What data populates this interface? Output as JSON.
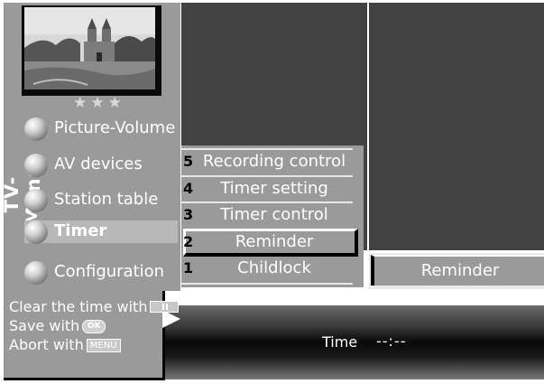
{
  "side_label": "TV-Menu",
  "rating_stars": "★★★",
  "main_menu": {
    "items": [
      {
        "label": "Picture-Volume"
      },
      {
        "label": "AV devices"
      },
      {
        "label": "Station table"
      },
      {
        "label": "Timer",
        "selected": true
      },
      {
        "label": "Configuration"
      }
    ]
  },
  "sub_menu": {
    "items": [
      {
        "number": "5",
        "label": "Recording control"
      },
      {
        "number": "4",
        "label": "Timer setting"
      },
      {
        "number": "3",
        "label": "Timer control"
      },
      {
        "number": "2",
        "label": "Reminder",
        "selected": true
      },
      {
        "number": "1",
        "label": "Childlock"
      }
    ]
  },
  "detail": {
    "title": "Reminder"
  },
  "help": {
    "clear_text": "Clear the time with",
    "save_text": "Save with",
    "abort_text": "Abort with",
    "ok_key": "OK",
    "menu_key": "MENU"
  },
  "bottom": {
    "time_label": "Time",
    "time_value": "--:--"
  },
  "colors": {
    "panel_gray": "#9a9a9a",
    "dark_gray": "#424242",
    "text": "#ffffff"
  },
  "icons": {
    "menu_bullet": "sphere-bullet-icon",
    "arrow": "right-pointer-icon"
  }
}
